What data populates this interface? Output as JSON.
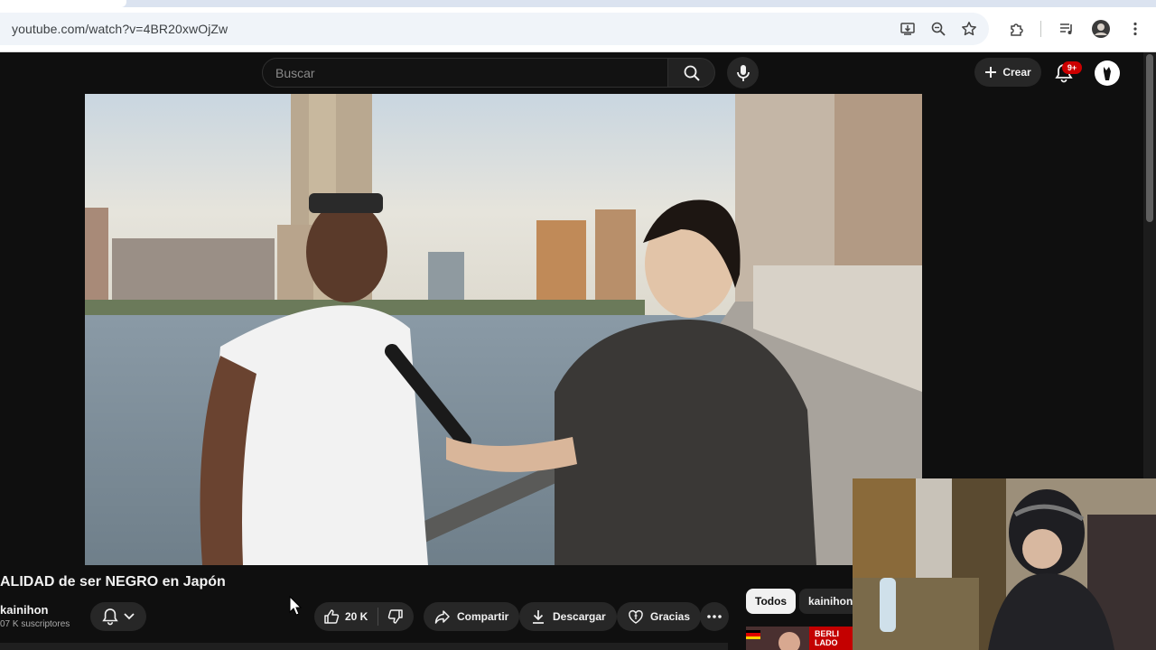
{
  "browser": {
    "url": "youtube.com/watch?v=4BR20xwOjZw",
    "icons": [
      "install-app-icon",
      "zoom-icon",
      "bookmark-star-icon",
      "extensions-icon",
      "media-control-icon",
      "profile-icon",
      "menu-icon"
    ]
  },
  "header": {
    "search_placeholder": "Buscar",
    "create_label": "Crear",
    "notification_count": "9+"
  },
  "video": {
    "title": "ALIDAD de ser NEGRO en Japón",
    "channel_name": "kainihon",
    "subscribers": "07 K suscriptores",
    "like_count": "20 K",
    "share_label": "Compartir",
    "download_label": "Descargar",
    "thanks_label": "Gracias"
  },
  "filters": {
    "all_label": "Todos",
    "channel_label": "kainihon"
  },
  "recommendation": {
    "thumb_text": "BERLI LADO"
  },
  "colors": {
    "background": "#0f0f0f",
    "pill": "#272727",
    "notification": "#cc0000",
    "text": "#f1f1f1"
  }
}
